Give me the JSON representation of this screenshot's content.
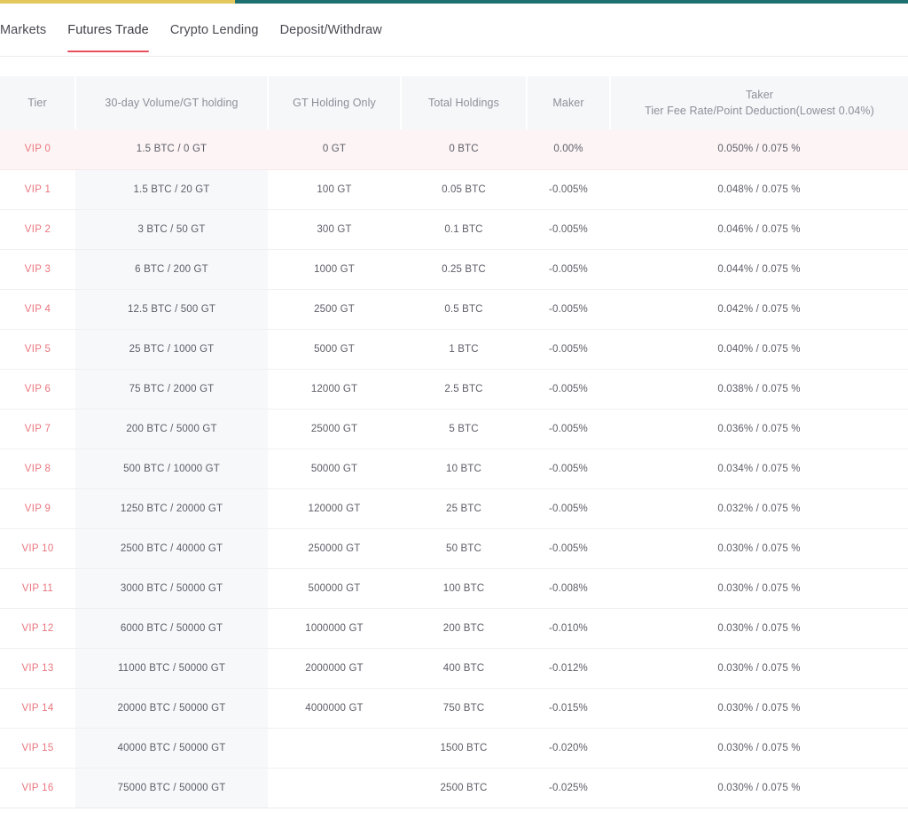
{
  "topbar": {
    "segments": [
      {
        "name": "yellow-segment",
        "color": "#e4c85b"
      },
      {
        "name": "teal-segment",
        "color": "#1e6f6f"
      }
    ]
  },
  "nav": {
    "items": [
      {
        "label": "Markets",
        "active": false
      },
      {
        "label": "Futures Trade",
        "active": true
      },
      {
        "label": "Crypto Lending",
        "active": false
      },
      {
        "label": "Deposit/Withdraw",
        "active": false
      }
    ],
    "active_underline_color": "#e8505f"
  },
  "table": {
    "columns": [
      {
        "key": "tier",
        "label": "Tier",
        "sublabel": ""
      },
      {
        "key": "volume",
        "label": "30-day Volume/GT holding",
        "sublabel": ""
      },
      {
        "key": "gt_holding_only",
        "label": "GT Holding Only",
        "sublabel": ""
      },
      {
        "key": "total_holdings",
        "label": "Total Holdings",
        "sublabel": ""
      },
      {
        "key": "maker",
        "label": "Maker",
        "sublabel": ""
      },
      {
        "key": "taker",
        "label": "Taker",
        "sublabel": "Tier Fee Rate/Point Deduction(Lowest 0.04%)"
      }
    ],
    "tier_label_color": "#ea767f",
    "highlight_row_color": "#fdf5f5",
    "rows": [
      {
        "tier": "VIP 0",
        "volume": "1.5 BTC / 0 GT",
        "gt_holding_only": "0 GT",
        "total_holdings": "0 BTC",
        "maker": "0.00%",
        "taker": "0.050% / 0.075 %",
        "highlight": true
      },
      {
        "tier": "VIP 1",
        "volume": "1.5 BTC / 20 GT",
        "gt_holding_only": "100 GT",
        "total_holdings": "0.05 BTC",
        "maker": "-0.005%",
        "taker": "0.048% / 0.075 %",
        "highlight": false
      },
      {
        "tier": "VIP 2",
        "volume": "3 BTC / 50 GT",
        "gt_holding_only": "300 GT",
        "total_holdings": "0.1 BTC",
        "maker": "-0.005%",
        "taker": "0.046% / 0.075 %",
        "highlight": false
      },
      {
        "tier": "VIP 3",
        "volume": "6 BTC / 200 GT",
        "gt_holding_only": "1000 GT",
        "total_holdings": "0.25 BTC",
        "maker": "-0.005%",
        "taker": "0.044% / 0.075 %",
        "highlight": false
      },
      {
        "tier": "VIP 4",
        "volume": "12.5 BTC / 500 GT",
        "gt_holding_only": "2500 GT",
        "total_holdings": "0.5 BTC",
        "maker": "-0.005%",
        "taker": "0.042% / 0.075 %",
        "highlight": false
      },
      {
        "tier": "VIP 5",
        "volume": "25 BTC / 1000 GT",
        "gt_holding_only": "5000 GT",
        "total_holdings": "1 BTC",
        "maker": "-0.005%",
        "taker": "0.040% / 0.075 %",
        "highlight": false
      },
      {
        "tier": "VIP 6",
        "volume": "75 BTC / 2000 GT",
        "gt_holding_only": "12000 GT",
        "total_holdings": "2.5 BTC",
        "maker": "-0.005%",
        "taker": "0.038% / 0.075 %",
        "highlight": false
      },
      {
        "tier": "VIP 7",
        "volume": "200 BTC / 5000 GT",
        "gt_holding_only": "25000 GT",
        "total_holdings": "5 BTC",
        "maker": "-0.005%",
        "taker": "0.036% / 0.075 %",
        "highlight": false
      },
      {
        "tier": "VIP 8",
        "volume": "500 BTC / 10000 GT",
        "gt_holding_only": "50000 GT",
        "total_holdings": "10 BTC",
        "maker": "-0.005%",
        "taker": "0.034% / 0.075 %",
        "highlight": false
      },
      {
        "tier": "VIP 9",
        "volume": "1250 BTC / 20000 GT",
        "gt_holding_only": "120000 GT",
        "total_holdings": "25 BTC",
        "maker": "-0.005%",
        "taker": "0.032% / 0.075 %",
        "highlight": false
      },
      {
        "tier": "VIP 10",
        "volume": "2500 BTC / 40000 GT",
        "gt_holding_only": "250000 GT",
        "total_holdings": "50 BTC",
        "maker": "-0.005%",
        "taker": "0.030% / 0.075 %",
        "highlight": false
      },
      {
        "tier": "VIP 11",
        "volume": "3000 BTC / 50000 GT",
        "gt_holding_only": "500000 GT",
        "total_holdings": "100 BTC",
        "maker": "-0.008%",
        "taker": "0.030% / 0.075 %",
        "highlight": false
      },
      {
        "tier": "VIP 12",
        "volume": "6000 BTC / 50000 GT",
        "gt_holding_only": "1000000 GT",
        "total_holdings": "200 BTC",
        "maker": "-0.010%",
        "taker": "0.030% / 0.075 %",
        "highlight": false
      },
      {
        "tier": "VIP 13",
        "volume": "11000 BTC / 50000 GT",
        "gt_holding_only": "2000000 GT",
        "total_holdings": "400 BTC",
        "maker": "-0.012%",
        "taker": "0.030% / 0.075 %",
        "highlight": false
      },
      {
        "tier": "VIP 14",
        "volume": "20000 BTC / 50000 GT",
        "gt_holding_only": "4000000 GT",
        "total_holdings": "750 BTC",
        "maker": "-0.015%",
        "taker": "0.030% / 0.075 %",
        "highlight": false
      },
      {
        "tier": "VIP 15",
        "volume": "40000 BTC / 50000 GT",
        "gt_holding_only": "",
        "total_holdings": "1500 BTC",
        "maker": "-0.020%",
        "taker": "0.030% / 0.075 %",
        "highlight": false
      },
      {
        "tier": "VIP 16",
        "volume": "75000 BTC / 50000 GT",
        "gt_holding_only": "",
        "total_holdings": "2500 BTC",
        "maker": "-0.025%",
        "taker": "0.030% / 0.075 %",
        "highlight": false
      }
    ]
  }
}
